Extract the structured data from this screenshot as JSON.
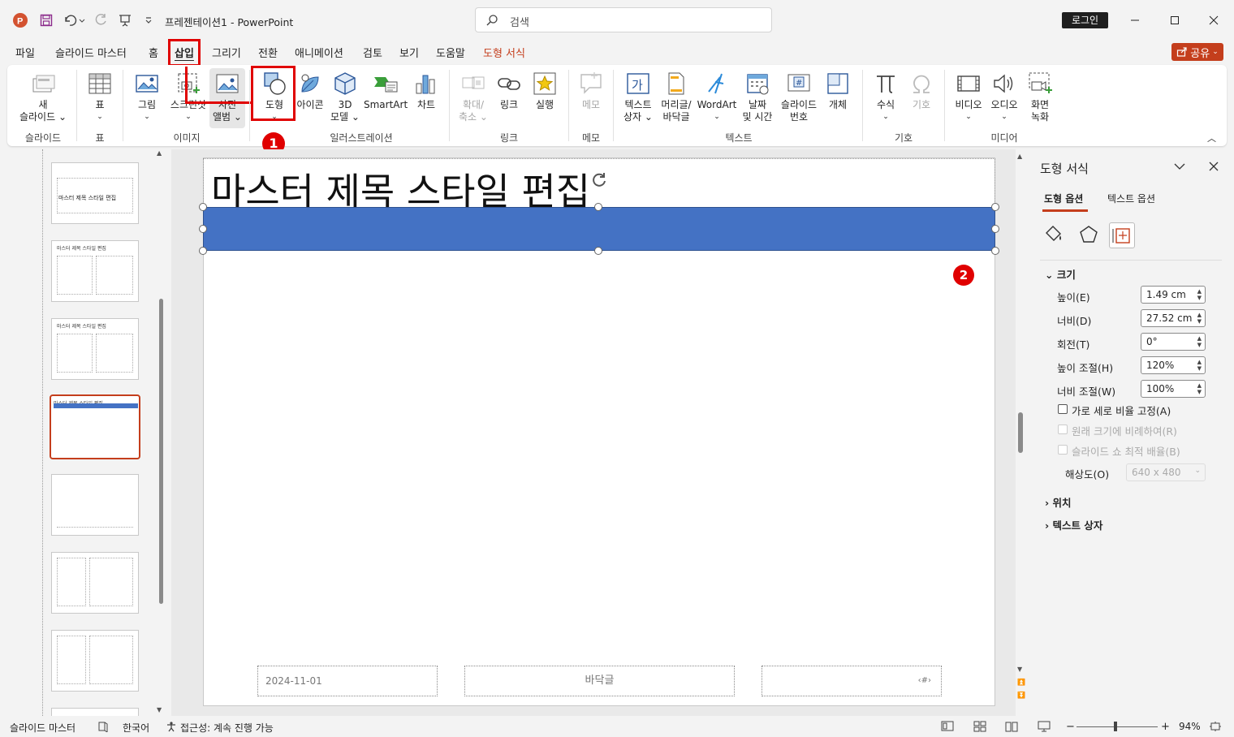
{
  "app": {
    "doc_title": "프레젠테이션1",
    "app_name": "PowerPoint",
    "search_placeholder": "검색",
    "login_label": "로그인",
    "share_label": "공유"
  },
  "menu": {
    "tabs": [
      "파일",
      "슬라이드 마스터",
      "홈",
      "삽입",
      "그리기",
      "전환",
      "애니메이션",
      "검토",
      "보기",
      "도움말",
      "도형 서식"
    ],
    "active_tab": "삽입",
    "contextual_color": "#c43e1c"
  },
  "ribbon": {
    "new_slide": [
      "새",
      "슬라이드"
    ],
    "table": "표",
    "picture": "그림",
    "screenshot": "스크린샷",
    "photo_album": [
      "사진",
      "앨범"
    ],
    "shapes": "도형",
    "icons": "아이콘",
    "model3d": [
      "3D",
      "모델"
    ],
    "smartart": "SmartArt",
    "chart": "차트",
    "zoom": [
      "확대/",
      "축소"
    ],
    "link": "링크",
    "action": "실행",
    "comment": "메모",
    "textbox": [
      "텍스트",
      "상자"
    ],
    "header_footer": [
      "머리글/",
      "바닥글"
    ],
    "wordart": "WordArt",
    "datetime": [
      "날짜",
      "및 시간"
    ],
    "slide_number": [
      "슬라이드",
      "번호"
    ],
    "object": "개체",
    "equation": "수식",
    "symbol": "기호",
    "video": "비디오",
    "audio": "오디오",
    "screen_recording": [
      "화면",
      "녹화"
    ],
    "groups": {
      "slides": "슬라이드",
      "tables": "표",
      "images": "이미지",
      "illustrations": "일러스트레이션",
      "links": "링크",
      "comments": "메모",
      "text": "텍스트",
      "symbols": "기호",
      "media": "미디어"
    }
  },
  "annotations": {
    "marker1": "1",
    "marker2": "2",
    "highlight_color": "#e00000"
  },
  "slide": {
    "title": "마스터 제목 스타일 편집",
    "date": "2024-11-01",
    "footer": "바닥글",
    "page_number": "‹#›",
    "shape_color": "#4472c4"
  },
  "thumbnails": {
    "title_text": "마스터 제목 스타일 편집"
  },
  "format_pane": {
    "title": "도형 서식",
    "tab_shape": "도형 옵션",
    "tab_text": "텍스트 옵션",
    "section_size": "크기",
    "height_label": "높이(E)",
    "height_value": "1.49 cm",
    "width_label": "너비(D)",
    "width_value": "27.52 cm",
    "rotation_label": "회전(T)",
    "rotation_value": "0°",
    "scale_h_label": "높이 조절(H)",
    "scale_h_value": "120%",
    "scale_w_label": "너비 조절(W)",
    "scale_w_value": "100%",
    "lock_aspect": "가로 세로 비율 고정(A)",
    "relative_original": "원래 크기에 비례하여(R)",
    "best_scale": "슬라이드 쇼 최적 배율(B)",
    "resolution_label": "해상도(O)",
    "resolution_value": "640 x 480",
    "section_position": "위치",
    "section_textbox": "텍스트 상자"
  },
  "status": {
    "view": "슬라이드 마스터",
    "language": "한국어",
    "accessibility": "접근성: 계속 진행 가능",
    "zoom": "94%"
  }
}
